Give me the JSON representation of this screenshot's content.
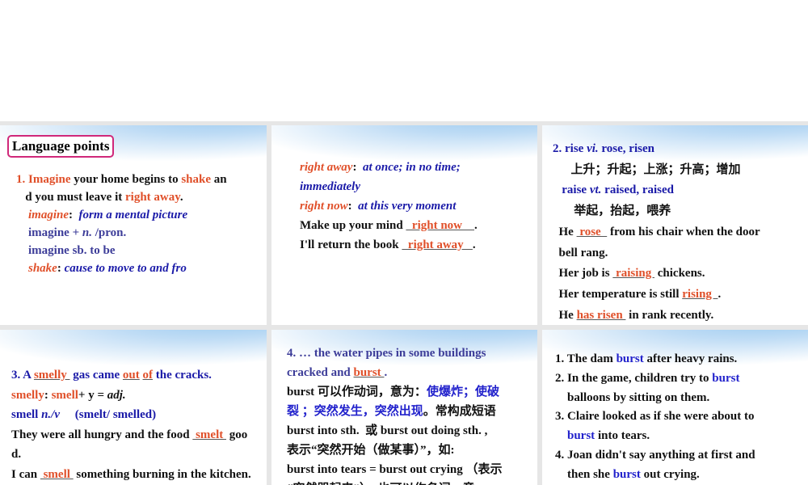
{
  "slides": [
    {
      "title": "Language points",
      "lines": [
        [
          [
            "1. Imagine",
            "o"
          ],
          [
            " your home begins to ",
            "k"
          ],
          [
            "shake",
            "o"
          ],
          [
            " an",
            "k"
          ]
        ],
        [
          [
            "   d you must leave it ",
            "k"
          ],
          [
            "right away",
            "o"
          ],
          [
            ".",
            "k"
          ]
        ],
        [
          [
            "    imagine",
            "oi"
          ],
          [
            ":  ",
            "k"
          ],
          [
            "form a mental picture",
            "bi"
          ]
        ],
        [
          [
            "    imagine + ",
            "p"
          ],
          [
            "n.",
            "p i"
          ],
          [
            " /pron.",
            "p"
          ]
        ],
        [
          [
            "    imagine sb. to be",
            "p"
          ]
        ],
        [
          [
            "    shake",
            "oi"
          ],
          [
            ": ",
            "k"
          ],
          [
            "cause to move to and fro",
            "bi"
          ]
        ]
      ]
    },
    {
      "lines": [
        [
          [
            "right away",
            "oi"
          ],
          [
            ":  ",
            "k"
          ],
          [
            "at once; in no time;",
            "bi"
          ]
        ],
        [
          [
            "immediately",
            "bi"
          ]
        ],
        [
          [
            "right now",
            "oi"
          ],
          [
            ":  ",
            "k"
          ],
          [
            "at this very moment",
            "bi"
          ]
        ],
        [
          [
            "Make up your mind ",
            "k"
          ],
          [
            "  right now    ",
            "u"
          ],
          [
            ".",
            "k"
          ]
        ],
        [
          [
            "I'll return the book ",
            "k"
          ],
          [
            "  right away   ",
            "u"
          ],
          [
            ".",
            "k"
          ]
        ]
      ]
    },
    {
      "lines": [
        [
          [
            "2. rise ",
            "b"
          ],
          [
            "vi.",
            "b i"
          ],
          [
            " rose, risen",
            "b"
          ]
        ],
        [
          [
            "      上升；升起；上涨；升高；增加",
            "k"
          ]
        ],
        [
          [
            "   raise ",
            "b"
          ],
          [
            "vt.",
            "b i"
          ],
          [
            " raised, raised",
            "b"
          ]
        ],
        [
          [
            "       举起，抬起，喂养",
            "k"
          ]
        ],
        [
          [
            "  He ",
            "k"
          ],
          [
            " rose  ",
            "u"
          ],
          [
            " from his chair when the door",
            "k"
          ]
        ],
        [
          [
            "  bell rang.",
            "k"
          ]
        ],
        [
          [
            "  Her job is ",
            "k"
          ],
          [
            " raising ",
            "u"
          ],
          [
            " chickens.",
            "k"
          ]
        ],
        [
          [
            "  Her temperature is still ",
            "k"
          ],
          [
            "rising  ",
            "u"
          ],
          [
            ".",
            "k"
          ]
        ],
        [
          [
            "  He ",
            "k"
          ],
          [
            "has risen ",
            "u"
          ],
          [
            " in rank recently.",
            "k"
          ]
        ]
      ]
    },
    {
      "lines": [
        [
          [
            "3. A ",
            "b"
          ],
          [
            "smelly ",
            "u"
          ],
          [
            " gas came ",
            "b"
          ],
          [
            "out",
            "u"
          ],
          [
            " ",
            "b"
          ],
          [
            "of",
            "u"
          ],
          [
            " the cracks.",
            "b"
          ]
        ],
        [
          [
            "smelly",
            "o"
          ],
          [
            ": ",
            "k"
          ],
          [
            "smell",
            "o"
          ],
          [
            "+ y = ",
            "k"
          ],
          [
            "adj.",
            "k i"
          ]
        ],
        [
          [
            "smell ",
            "b"
          ],
          [
            "n./v",
            "b i"
          ],
          [
            "     (smelt/ smelled)",
            "b"
          ]
        ],
        [
          [
            "They were all hungry and the food ",
            "k"
          ],
          [
            " smelt ",
            "u"
          ],
          [
            " goo",
            "k"
          ]
        ],
        [
          [
            "d.",
            "k"
          ]
        ],
        [
          [
            "I can ",
            "k"
          ],
          [
            " smell ",
            "u"
          ],
          [
            " something burning in the kitchen.",
            "k"
          ]
        ]
      ]
    },
    {
      "lines": [
        [
          [
            "4. … the water pipes in some buildings",
            "p"
          ]
        ],
        [
          [
            "cracked and ",
            "p"
          ],
          [
            "burst ",
            "u"
          ],
          [
            ".",
            "p"
          ]
        ],
        [
          [
            "burst 可以作动词，意为：",
            "k"
          ],
          [
            "使爆炸；使破",
            "bl"
          ]
        ],
        [
          [
            "裂 ；突然发生，突然出现",
            "bl"
          ],
          [
            "。常构成短语",
            "k"
          ]
        ],
        [
          [
            "burst into sth.  或 burst out doing sth. ,",
            "k"
          ]
        ],
        [
          [
            "表示“突然开始（做某事）”，如:",
            "k"
          ]
        ],
        [
          [
            "burst into tears = burst out crying （表示",
            "k"
          ]
        ],
        [
          [
            "“突然哭起来”），也可以作名词，意",
            "k"
          ]
        ]
      ]
    },
    {
      "lines": [
        [
          [
            "1. The dam ",
            "k"
          ],
          [
            "burst",
            "bl"
          ],
          [
            " after heavy rains.",
            "k"
          ]
        ],
        [
          [
            "2. In the game, children try to ",
            "k"
          ],
          [
            "burst",
            "bl"
          ]
        ],
        [
          [
            "    balloons by sitting on them.",
            "k"
          ]
        ],
        [
          [
            "3. Claire looked as if she were about to",
            "k"
          ]
        ],
        [
          [
            "    ",
            "k"
          ],
          [
            "burst",
            "bl"
          ],
          [
            " into tears.",
            "k"
          ]
        ],
        [
          [
            "4. Joan didn't say anything at first and",
            "k"
          ]
        ],
        [
          [
            "    then she ",
            "k"
          ],
          [
            "burst",
            "bl"
          ],
          [
            " out crying.",
            "k"
          ]
        ]
      ]
    }
  ]
}
